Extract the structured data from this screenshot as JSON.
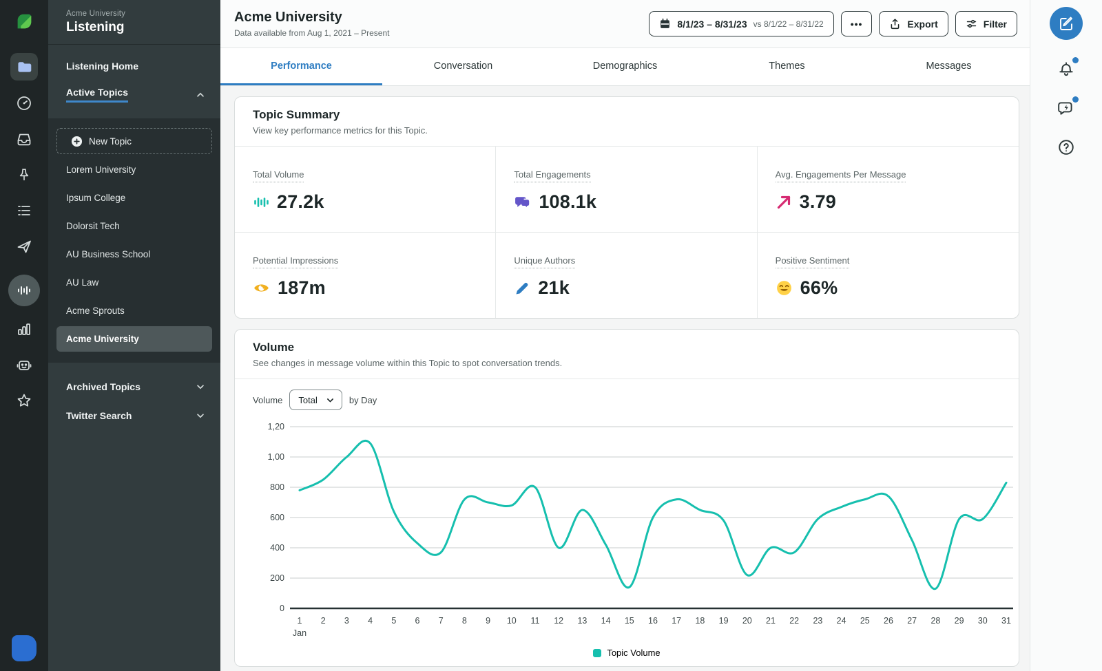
{
  "sidebar": {
    "workspace": "Acme University",
    "product": "Listening",
    "nav_home": "Listening Home",
    "nav_active_topics": "Active Topics",
    "new_topic_label": "New Topic",
    "topics": [
      "Lorem University",
      "Ipsum College",
      "Dolorsit Tech",
      "AU Business School",
      "AU Law",
      "Acme Sprouts",
      "Acme University"
    ],
    "selected_topic": "Acme University",
    "groups": [
      "Archived Topics",
      "Twitter Search"
    ]
  },
  "header": {
    "title": "Acme University",
    "subtitle": "Data available from Aug 1, 2021 – Present",
    "date_range": "8/1/23 – 8/31/23",
    "date_compare": "vs 8/1/22 – 8/31/22",
    "more_label": "•••",
    "export_label": "Export",
    "filter_label": "Filter"
  },
  "tabs": [
    {
      "label": "Performance",
      "active": true
    },
    {
      "label": "Conversation",
      "active": false
    },
    {
      "label": "Demographics",
      "active": false
    },
    {
      "label": "Themes",
      "active": false
    },
    {
      "label": "Messages",
      "active": false
    }
  ],
  "topic_summary": {
    "title": "Topic Summary",
    "subtitle": "View key performance metrics for this Topic.",
    "metrics": [
      {
        "label": "Total Volume",
        "value": "27.2k",
        "icon": "volume-waveform-icon",
        "color": "#16bfae"
      },
      {
        "label": "Total Engagements",
        "value": "108.1k",
        "icon": "chat-bubbles-icon",
        "color": "#6456c9"
      },
      {
        "label": "Avg. Engagements Per Message",
        "value": "3.79",
        "icon": "trend-up-arrow-icon",
        "color": "#d62b72"
      },
      {
        "label": "Potential Impressions",
        "value": "187m",
        "icon": "eye-icon",
        "color": "#f1af1d"
      },
      {
        "label": "Unique Authors",
        "value": "21k",
        "icon": "pencil-icon",
        "color": "#2e7dc2"
      },
      {
        "label": "Positive Sentiment",
        "value": "66%",
        "icon": "smiley-icon",
        "color": "#ffd147"
      }
    ]
  },
  "volume_card": {
    "title": "Volume",
    "subtitle": "See changes in message volume within this Topic to spot conversation trends.",
    "controls": {
      "label": "Volume",
      "select_value": "Total",
      "suffix": "by Day"
    }
  },
  "chart_data": {
    "type": "line",
    "title": "Volume by Day",
    "x": [
      1,
      2,
      3,
      4,
      5,
      6,
      7,
      8,
      9,
      10,
      11,
      12,
      13,
      14,
      15,
      16,
      17,
      18,
      19,
      20,
      21,
      22,
      23,
      24,
      25,
      26,
      27,
      28,
      29,
      30,
      31
    ],
    "x_label_month": "Jan",
    "series": [
      {
        "name": "Topic Volume",
        "color": "#16bfae",
        "values": [
          780,
          850,
          1000,
          1090,
          640,
          430,
          370,
          720,
          700,
          680,
          800,
          400,
          650,
          420,
          140,
          600,
          720,
          650,
          580,
          220,
          400,
          370,
          590,
          670,
          720,
          740,
          450,
          130,
          590,
          590,
          830
        ]
      }
    ],
    "ylim": [
      0,
      1200
    ],
    "y_ticks": {
      "labels": [
        "1,20",
        "1,00",
        "800",
        "600",
        "400",
        "200",
        "0"
      ],
      "values": [
        1200,
        1000,
        800,
        600,
        400,
        200,
        0
      ]
    },
    "grid": true,
    "legend_position": "bottom",
    "legend": [
      {
        "label": "Topic Volume",
        "color": "#16bfae"
      }
    ]
  }
}
